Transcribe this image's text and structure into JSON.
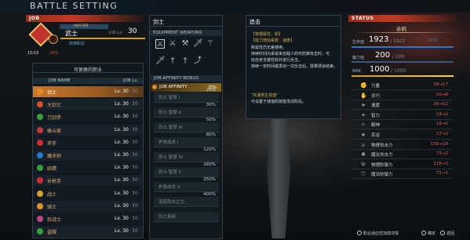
{
  "header": {
    "title": "BATTLE SETTING"
  },
  "job_section": {
    "label": "JOB",
    "current": {
      "badge": "MASTER",
      "name": "武士",
      "level_label": "JOB Lv.",
      "level": "30",
      "sub": "转换职业",
      "stat1": "15/15",
      "stat2": "20%"
    },
    "list_title": "可更换的职业",
    "col_name": "JOB NAME",
    "col_level": "JOB Lv.",
    "jobs": [
      {
        "name": "剑士",
        "level": "Lv. 30",
        "max": "30",
        "color": "#e0882a",
        "selected": true
      },
      {
        "name": "大剑士",
        "level": "Lv. 30",
        "max": "30",
        "color": "#d84d2a"
      },
      {
        "name": "刀剑手",
        "level": "Lv. 30",
        "max": "30",
        "color": "#3aa040"
      },
      {
        "name": "格斗家",
        "level": "Lv. 30",
        "max": "30",
        "color": "#c03a3a"
      },
      {
        "name": "斧手",
        "level": "Lv. 30",
        "max": "30",
        "color": "#c83030"
      },
      {
        "name": "魔术师",
        "level": "Lv. 30",
        "max": "30",
        "color": "#2a78c8"
      },
      {
        "name": "妖精",
        "level": "Lv. 30",
        "max": "30",
        "color": "#3aa040"
      },
      {
        "name": "长枪手",
        "level": "Lv. 30",
        "max": "30",
        "color": "#c83030"
      },
      {
        "name": "战士",
        "level": "Lv. 30",
        "max": "30",
        "color": "#d8a030"
      },
      {
        "name": "骑士",
        "level": "Lv. 30",
        "max": "30",
        "color": "#d89030"
      },
      {
        "name": "狂战士",
        "level": "Lv. 30",
        "max": "30",
        "color": "#c04a8a"
      },
      {
        "name": "盗贼",
        "level": "Lv. 30",
        "max": "30",
        "color": "#3aa040"
      }
    ]
  },
  "job_detail": {
    "name": "剑士",
    "equip_label": "EQUIPMENT WEAPONS",
    "weapons": [
      "sword",
      "sword",
      "axe",
      "blade",
      "wand",
      "blade",
      "dagger",
      "dagger",
      "spear"
    ],
    "bonus_label": "JOB AFFINITY BONUS",
    "affinity_label": "JOB AFFINITY",
    "affinity_value": "0%",
    "bonuses": [
      {
        "name": "剑士 智慧 I",
        "pct": "20%"
      },
      {
        "name": "剑士 智慧 II",
        "pct": "30%"
      },
      {
        "name": "剑士 智慧 III",
        "pct": "50%"
      },
      {
        "name": "护身战术 I",
        "pct": "80%"
      },
      {
        "name": "剑士 智慧 IV",
        "pct": "120%"
      },
      {
        "name": "剑士 智慧 V",
        "pct": "160%"
      },
      {
        "name": "护身战术 II",
        "pct": "250%"
      },
      {
        "name": "连招攻击之力",
        "pct": "400%"
      },
      {
        "name": "剑之奥秘",
        "pct": ""
      }
    ]
  },
  "skill": {
    "title": "追击",
    "tag1": "【物理属性：斩】",
    "tag2": "【能力增加系数：速度】",
    "desc1": "新属性仍无差使用。",
    "desc2": "持续时间内承受来自敌人的可防御攻击时，可",
    "desc3": "给自身支援性收并进行反击。",
    "desc4": "持续一定时间或发动一次反击后，效果便会结束。",
    "note_title": "\"共通类生技能\"",
    "note": "可设置于通道的技能发动阶段。"
  },
  "status": {
    "label": "STATUS",
    "name": "赤鸦",
    "hp_label": "生命值",
    "hp": "1923",
    "hp_max": "/ 1923",
    "hp_frac": "2732",
    "mp_label": "魔力值",
    "mp": "200",
    "mp_max": "/ 200",
    "brk_label": "BRK",
    "brk": "1000",
    "brk_max": "/ 1000",
    "stats": [
      {
        "name": "力量",
        "value": "39→17",
        "icon": "✊"
      },
      {
        "name": "灵巧",
        "value": "20→8",
        "icon": "✋"
      },
      {
        "name": "速度",
        "value": "26→12",
        "icon": "➤"
      },
      {
        "name": "智力",
        "value": "18→2",
        "icon": "✦"
      },
      {
        "name": "精神",
        "value": "16→2",
        "icon": "✧"
      },
      {
        "name": "幸运",
        "value": "17→2",
        "icon": "★"
      },
      {
        "name": "物理攻击力",
        "value": "139→18",
        "icon": "⚔"
      },
      {
        "name": "魔法攻击力",
        "value": "73→2",
        "icon": "✺"
      },
      {
        "name": "物理防御力",
        "value": "118→3",
        "icon": "⛨"
      },
      {
        "name": "魔法防御力",
        "value": "73→1",
        "icon": "⛉"
      }
    ]
  },
  "footer": {
    "hint1": "职业适应性加成详情",
    "hint2": "确定",
    "hint3": "返回"
  },
  "colors": {
    "accent": "#c43a22",
    "gold": "#d8b14a",
    "hp": "#3a8ac8",
    "mp": "#2a6aa8",
    "brk": "#c89a3a"
  }
}
